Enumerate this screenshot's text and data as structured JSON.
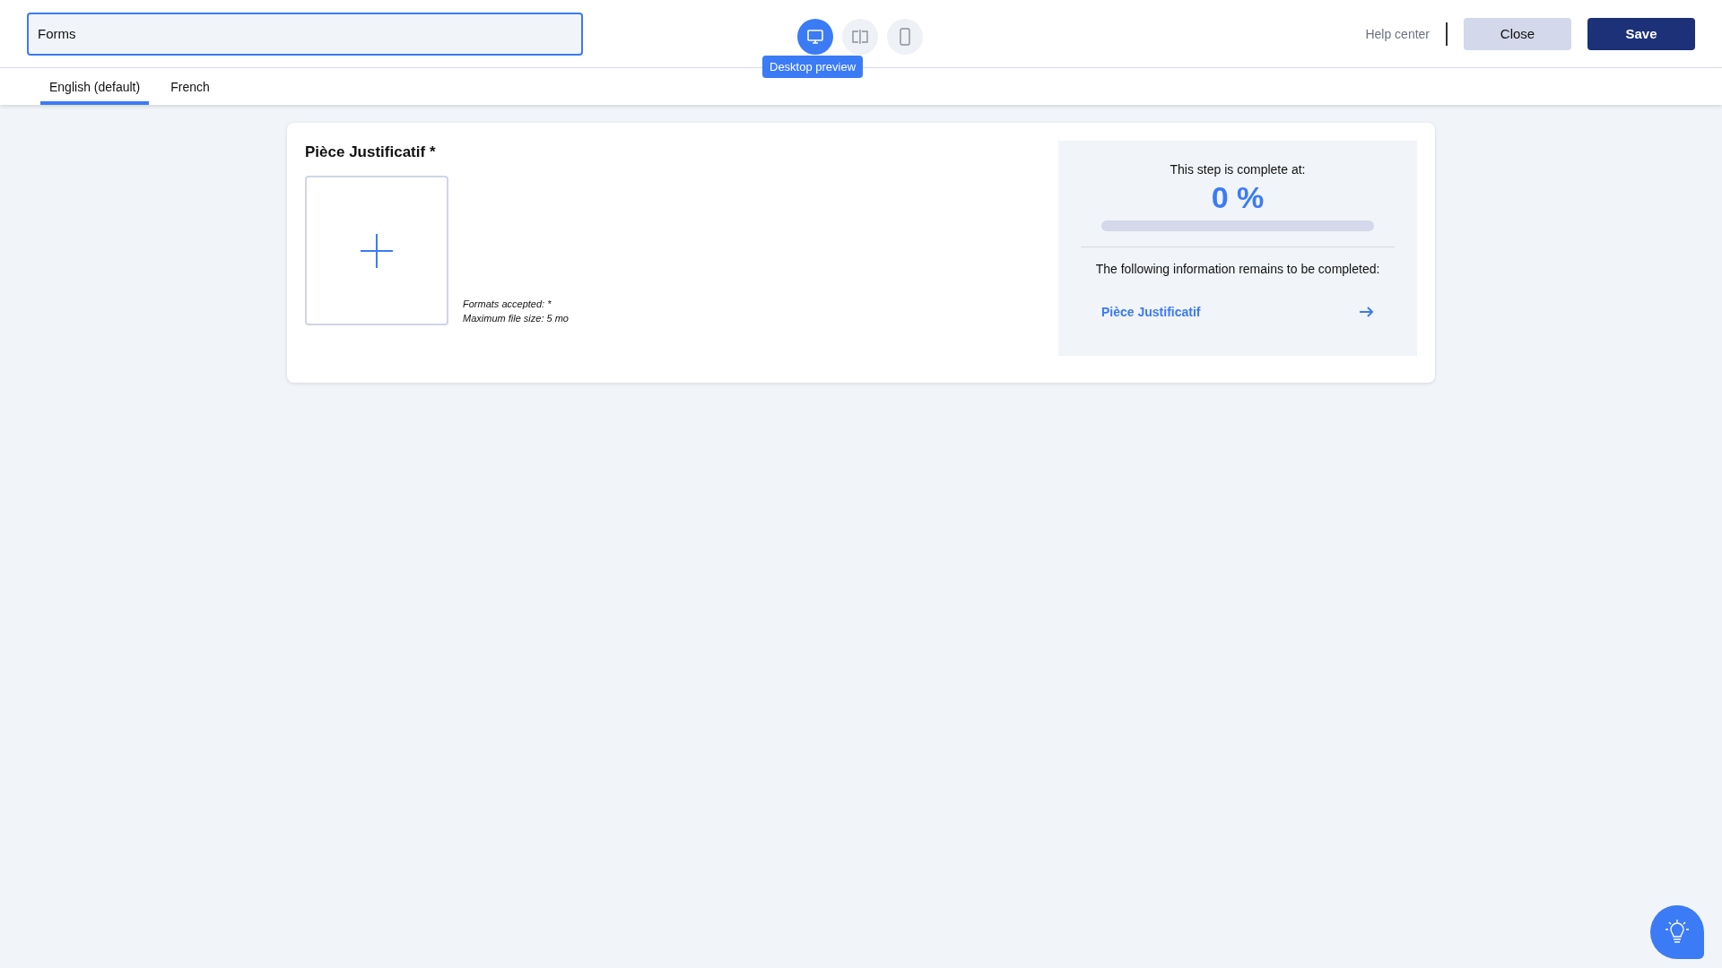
{
  "title_field": {
    "value": "Forms"
  },
  "preview_modes": [
    {
      "kind": "desktop",
      "selected": true
    },
    {
      "kind": "split",
      "selected": false
    },
    {
      "kind": "mobile",
      "selected": false
    }
  ],
  "tooltip": "Desktop preview",
  "header_links": [
    "Help center"
  ],
  "buttons": [
    {
      "label": "Close",
      "kind": "secondary"
    },
    {
      "label": "Save",
      "kind": "primary"
    }
  ],
  "tabs": [
    {
      "label": "English (default)",
      "selected": true
    },
    {
      "label": "French",
      "selected": false
    }
  ],
  "field": {
    "label": "Pièce Justificatif *",
    "formats": "Formats accepted: *",
    "max_size": "Maximum file size: 5 mo"
  },
  "progress": {
    "caption": "This step is complete at:",
    "percent": "0 %",
    "level": 0,
    "remaining_title": "The following information remains to be completed:",
    "remaining": [
      "Pièce Justificatif"
    ]
  }
}
